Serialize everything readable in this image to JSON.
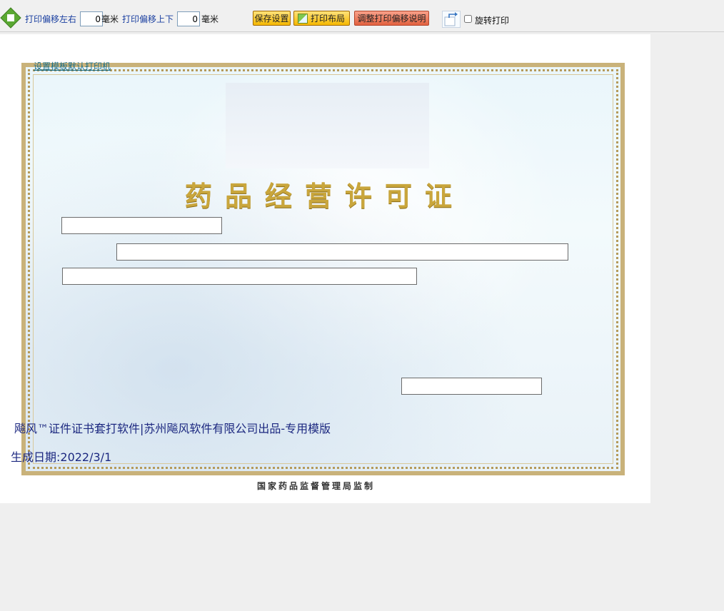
{
  "toolbar": {
    "offset_lr_label": "打印偏移左右",
    "offset_lr_value": "0",
    "offset_lr_unit": "毫米",
    "offset_ud_label": "打印偏移上下",
    "offset_ud_value": "0",
    "offset_ud_unit": "毫米",
    "save_label": "保存设置",
    "layout_label": "打印布局",
    "help_label": "调整打印偏移说明",
    "rotate_label": "旋转打印"
  },
  "page": {
    "set_printer_link": "设置模板默认打印机",
    "certificate_title": "药品经营许可证",
    "footer_software": "飚风™证件证书套打软件|苏州飚风软件有限公司出品-专用模版",
    "footer_date": "生成日期:2022/3/1",
    "authority": "国家药品监督管理局监制"
  },
  "colors": {
    "accent_gold": "#c9a63c",
    "link_blue": "#1a3fa0",
    "footer_text": "#1c2880"
  }
}
